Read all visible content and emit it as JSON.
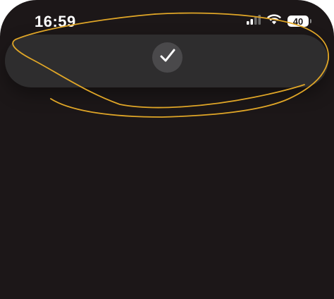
{
  "status_bar": {
    "time": "16:59",
    "battery_level": "40",
    "signal_icon": "cellular-signal-icon",
    "wifi_icon": "wifi-icon"
  },
  "banner": {
    "icon": "checkmark-icon"
  },
  "colors": {
    "background": "#1c1718",
    "banner": "#2e2d2e",
    "check_circle": "#4a494b",
    "annotation_stroke": "#e0a627"
  }
}
